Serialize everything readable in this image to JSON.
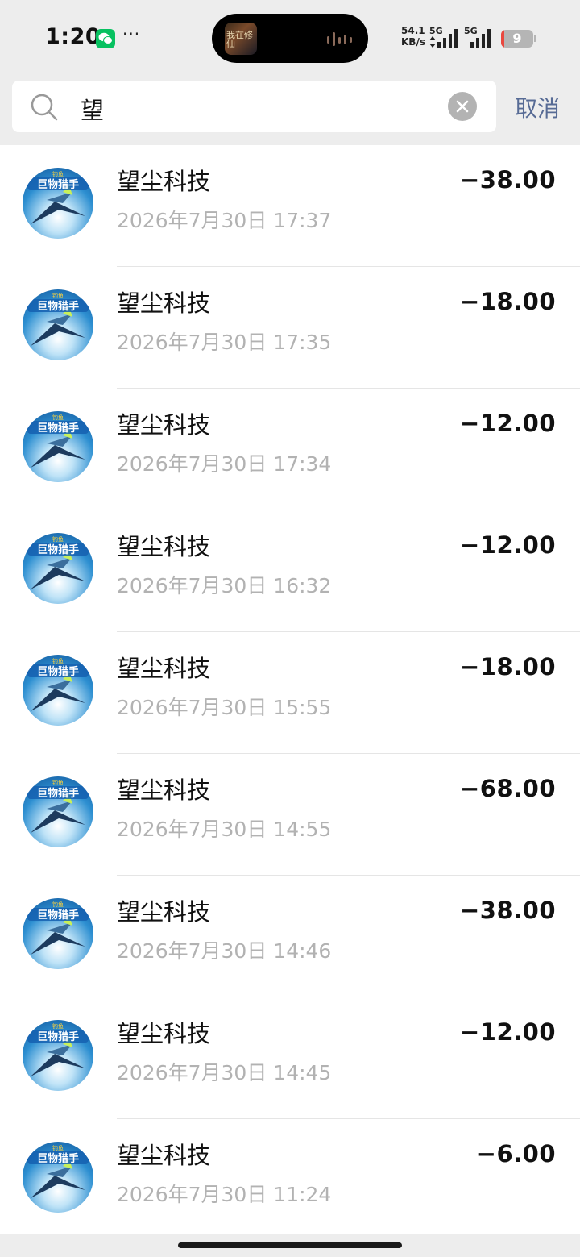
{
  "status_bar": {
    "time": "1:20",
    "more": "···",
    "net_speed_value": "54.1",
    "net_speed_unit": "KB/s",
    "sim1_label": "5G",
    "sim2_label": "5G",
    "battery_level": "9",
    "battery_color": "#e9483f",
    "island_art_text": "我在修仙"
  },
  "search": {
    "query": "望",
    "cancel_label": "取消"
  },
  "transactions": [
    {
      "merchant": "望尘科技",
      "datetime": "2026年7月30日 17:37",
      "amount": "−38.00"
    },
    {
      "merchant": "望尘科技",
      "datetime": "2026年7月30日 17:35",
      "amount": "−18.00"
    },
    {
      "merchant": "望尘科技",
      "datetime": "2026年7月30日 17:34",
      "amount": "−12.00"
    },
    {
      "merchant": "望尘科技",
      "datetime": "2026年7月30日 16:32",
      "amount": "−12.00"
    },
    {
      "merchant": "望尘科技",
      "datetime": "2026年7月30日 15:55",
      "amount": "−18.00"
    },
    {
      "merchant": "望尘科技",
      "datetime": "2026年7月30日 14:55",
      "amount": "−68.00"
    },
    {
      "merchant": "望尘科技",
      "datetime": "2026年7月30日 14:46",
      "amount": "−38.00"
    },
    {
      "merchant": "望尘科技",
      "datetime": "2026年7月30日 14:45",
      "amount": "−12.00"
    },
    {
      "merchant": "望尘科技",
      "datetime": "2026年7月30日 11:24",
      "amount": "−6.00"
    }
  ],
  "avatar": {
    "line1": "钓鱼",
    "line2": "巨物猎手"
  },
  "colors": {
    "link": "#576b95",
    "secondary_text": "#b2b2b2",
    "background": "#ededed"
  }
}
